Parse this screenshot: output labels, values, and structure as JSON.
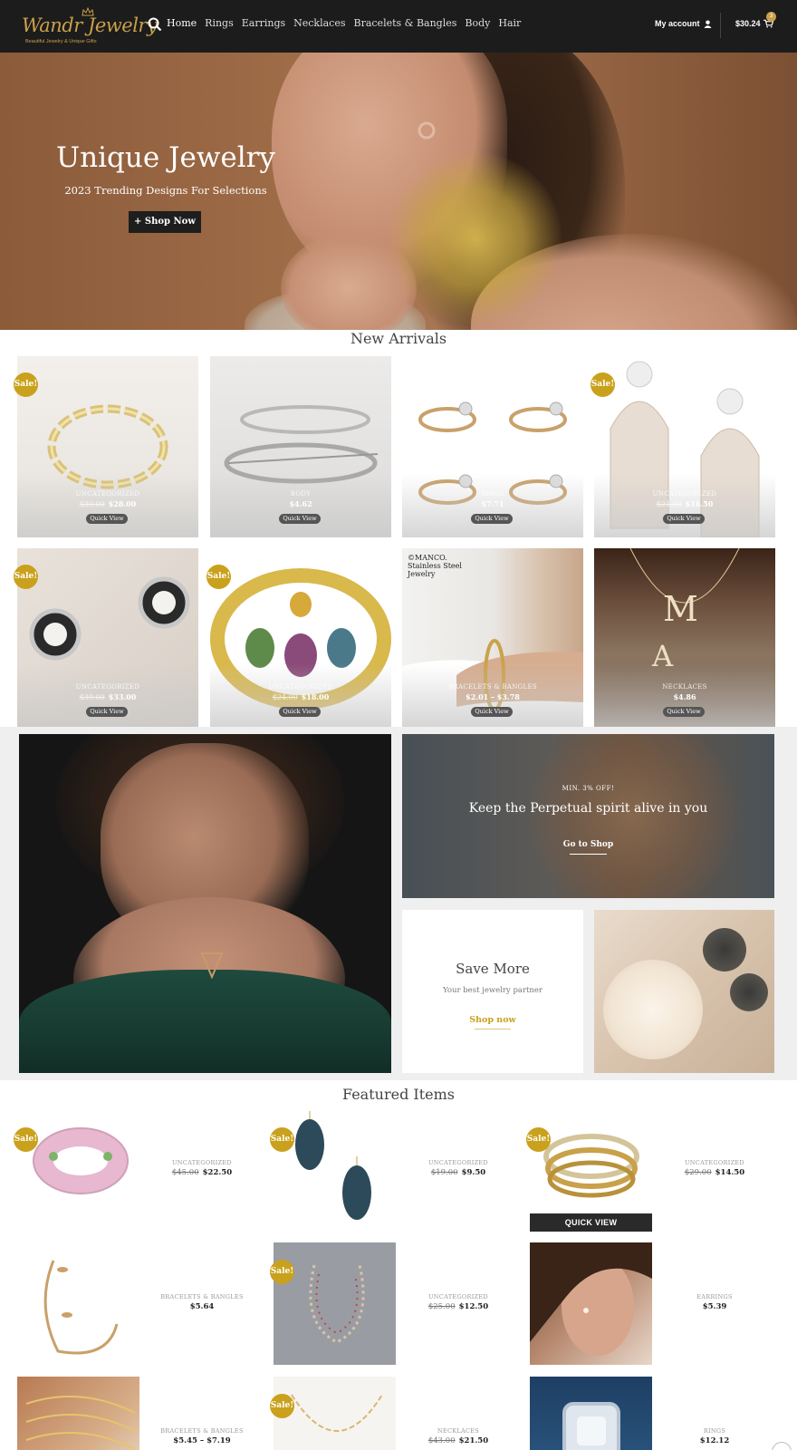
{
  "brand": {
    "name": "Wandr Jewelry",
    "tagline": "Beautiful Jewelry & Unique Gifts"
  },
  "nav": {
    "items": [
      {
        "label": "Home",
        "active": true
      },
      {
        "label": "Rings"
      },
      {
        "label": "Earrings"
      },
      {
        "label": "Necklaces"
      },
      {
        "label": "Bracelets & Bangles"
      },
      {
        "label": "Body"
      },
      {
        "label": "Hair"
      }
    ],
    "account_label": "My account",
    "cart_total": "$30.24",
    "cart_count": "3"
  },
  "hero": {
    "title": "Unique Jewelry",
    "subtitle": "2023 Trending Designs For Selections",
    "button_label": "+ Shop Now"
  },
  "new_arrivals": {
    "title": "New Arrivals",
    "quick_view_label": "Quick View",
    "sale_label": "Sale!",
    "products": [
      {
        "image": "gold-chain-bracelet",
        "category": "UNCATEGORIZED",
        "old_price": "$30.00",
        "price": "$28.00",
        "sale": true
      },
      {
        "image": "silver-filigree-brooch",
        "category": "BODY",
        "old_price": "",
        "price": "$4.62",
        "sale": false
      },
      {
        "image": "letter-rings",
        "category": "RINGS",
        "old_price": "",
        "price": "$7.71",
        "sale": false
      },
      {
        "image": "crystal-fringe-earrings",
        "category": "UNCATEGORIZED",
        "old_price": "$21.00",
        "price": "$16.50",
        "sale": true
      },
      {
        "image": "pearl-stud-earrings",
        "category": "UNCATEGORIZED",
        "old_price": "$39.00",
        "price": "$33.00",
        "sale": true
      },
      {
        "image": "multicolor-crystal-bangle",
        "category": "UNCATEGORIZED",
        "old_price": "$24.00",
        "price": "$18.00",
        "sale": true
      },
      {
        "image": "figaro-chain-bracelet",
        "category": "BRACELETS & BANGLES",
        "old_price": "",
        "price": "$2.01 – $3.78",
        "sale": false,
        "watermark": "©MANCO. Stainless Steel Jewelry"
      },
      {
        "image": "initial-letter-necklace",
        "category": "NECKLACES",
        "old_price": "",
        "price": "$4.86",
        "sale": false
      }
    ]
  },
  "promo": {
    "banner_kicker": "MIN. 3% OFF!",
    "banner_headline": "Keep the Perpetual spirit alive in you",
    "banner_link": "Go to Shop",
    "save_title": "Save More",
    "save_subtitle": "Your best jewelry partner",
    "save_link": "Shop now"
  },
  "featured": {
    "title": "Featured Items",
    "quick_view_label": "QUICK VIEW",
    "items": [
      {
        "image": "pink-crystal-stretch-bracelet",
        "category": "UNCATEGORIZED",
        "old_price": "$45.00",
        "price": "$22.50",
        "sale": true
      },
      {
        "image": "blue-druzy-drop-earrings",
        "category": "UNCATEGORIZED",
        "old_price": "$19.00",
        "price": "$9.50",
        "sale": true
      },
      {
        "image": "gold-bead-bracelet-stack",
        "category": "UNCATEGORIZED",
        "old_price": "$29.00",
        "price": "$14.50",
        "sale": true
      },
      {
        "image": "gold-leaf-cuff-bangle",
        "category": "BRACELETS & BANGLES",
        "old_price": "",
        "price": "$5.64",
        "sale": false
      },
      {
        "image": "beaded-chain-necklace",
        "category": "UNCATEGORIZED",
        "old_price": "$25.00",
        "price": "$12.50",
        "sale": true
      },
      {
        "image": "pearl-drop-earring-model",
        "category": "EARRINGS",
        "old_price": "",
        "price": "$5.39",
        "sale": false
      },
      {
        "image": "layered-gold-bracelets",
        "category": "BRACELETS & BANGLES",
        "old_price": "",
        "price": "$5.45 – $7.19",
        "sale": false
      },
      {
        "image": "gold-link-necklace",
        "category": "NECKLACES",
        "old_price": "$43.00",
        "price": "$21.50",
        "sale": true
      },
      {
        "image": "diamond-cocktail-ring",
        "category": "RINGS",
        "old_price": "",
        "price": "$12.12",
        "sale": false
      }
    ]
  },
  "colors": {
    "header_bg": "#1c1c1c",
    "accent_gold": "#c9a11c",
    "button_dark": "#1e1e1e"
  }
}
